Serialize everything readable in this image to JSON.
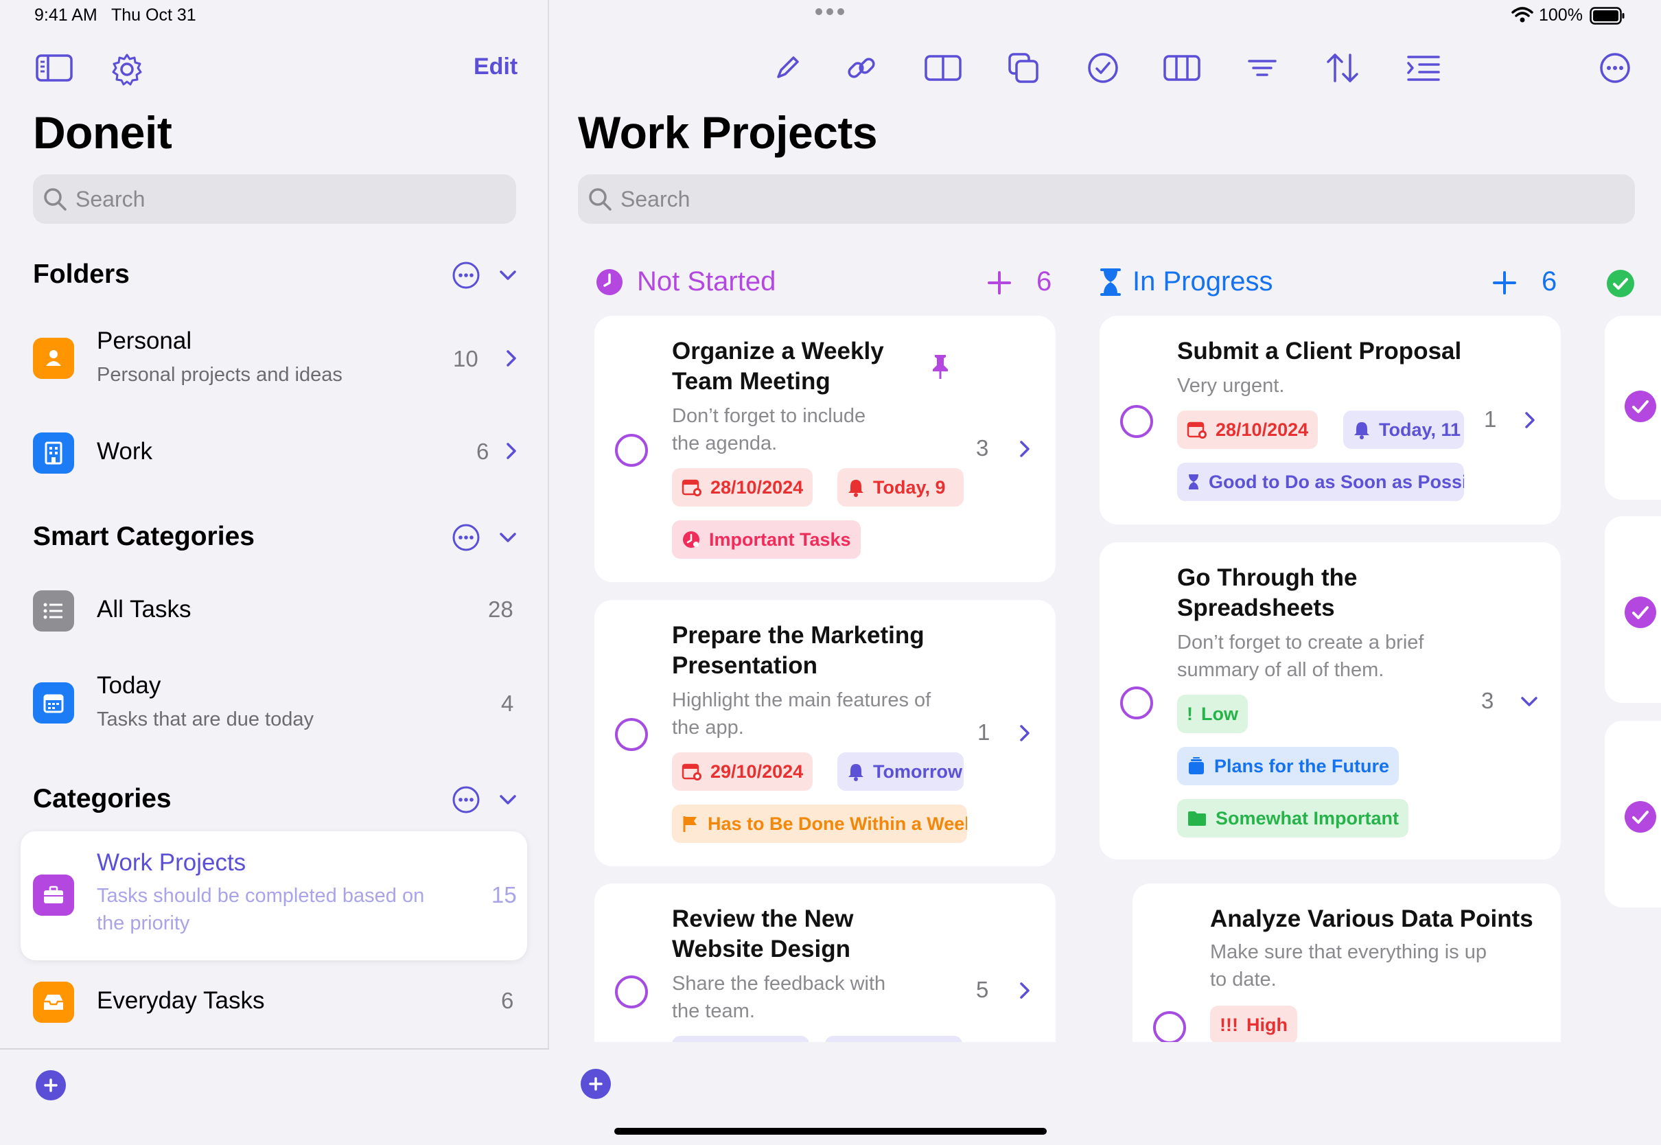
{
  "status": {
    "time": "9:41 AM",
    "date": "Thu Oct 31",
    "battery": "100%"
  },
  "sidebar": {
    "edit_label": "Edit",
    "title": "Doneit",
    "search_placeholder": "Search",
    "folders": {
      "heading": "Folders",
      "items": [
        {
          "title": "Personal",
          "subtitle": "Personal projects and ideas",
          "count": "10",
          "color": "#ff9500",
          "icon": "person-icon"
        },
        {
          "title": "Work",
          "subtitle": "",
          "count": "6",
          "color": "#1b7cf5",
          "icon": "building-icon"
        }
      ]
    },
    "smart": {
      "heading": "Smart Categories",
      "items": [
        {
          "title": "All Tasks",
          "subtitle": "",
          "count": "28",
          "color": "#8e8e93",
          "icon": "list-icon"
        },
        {
          "title": "Today",
          "subtitle": "Tasks that are due today",
          "count": "4",
          "color": "#1b7cf5",
          "icon": "calendar-icon"
        }
      ]
    },
    "categories": {
      "heading": "Categories",
      "items": [
        {
          "title": "Work Projects",
          "subtitle_line1": "Tasks should be completed based on",
          "subtitle_line2": "the priority",
          "count": "15",
          "color": "#b347e0",
          "icon": "briefcase-icon"
        },
        {
          "title": "Everyday Tasks",
          "subtitle": "",
          "count": "6",
          "color": "#ff9500",
          "icon": "tray-icon"
        }
      ]
    }
  },
  "main": {
    "title": "Work Projects",
    "search_placeholder": "Search",
    "columns": [
      {
        "name": "Not Started",
        "count": "6",
        "color": "#b347e0",
        "cards": [
          {
            "title1": "Organize a Weekly",
            "title2": "Team Meeting",
            "note1": "Don’t forget to include",
            "note2": "the agenda.",
            "count": "3",
            "tags": [
              "28/10/2024",
              "Today, 9",
              "Important Tasks"
            ]
          },
          {
            "title1": "Prepare the Marketing",
            "title2": "Presentation",
            "note1": "Highlight the main features of",
            "note2": "the app.",
            "count": "1",
            "tags": [
              "29/10/2024",
              "Tomorrow",
              "Has to Be Done Within a Week"
            ]
          },
          {
            "title1": "Review the New",
            "title2": "Website Design",
            "note1": "Share the feedback with",
            "note2": "the team.",
            "count": "5",
            "tags": []
          }
        ]
      },
      {
        "name": "In Progress",
        "count": "6",
        "color": "#1673f0",
        "cards": [
          {
            "title1": "Submit a Client Proposal",
            "note1": "Very urgent.",
            "count": "1",
            "tags": [
              "28/10/2024",
              "Today, 11",
              "Good to Do as Soon as Possible"
            ]
          },
          {
            "title1": "Go Through the",
            "title2": "Spreadsheets",
            "note1": "Don’t forget to create a brief",
            "note2": "summary of all of them.",
            "count": "3",
            "tags": [
              "Low",
              "Plans for the Future",
              "Somewhat Important"
            ]
          },
          {
            "title1": "Analyze Various Data Points",
            "note1": "Make sure that everything is up",
            "note2": "to date.",
            "tags": [
              "High"
            ]
          }
        ]
      }
    ]
  }
}
